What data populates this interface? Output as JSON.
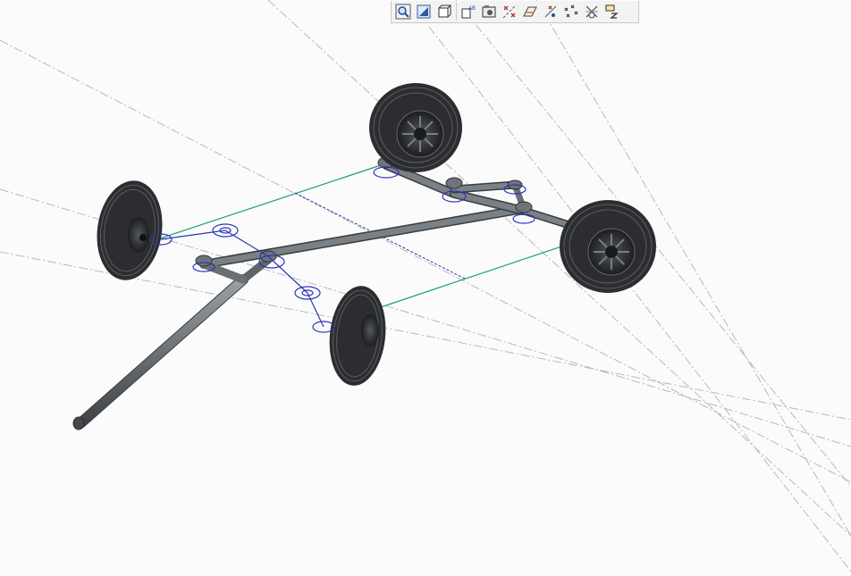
{
  "window": {
    "kind": "3d-cad-graphics-window"
  },
  "toolbar": {
    "buttons": [
      {
        "icon": "zoom-to-fit-icon"
      },
      {
        "icon": "zoom-area-icon"
      },
      {
        "icon": "view-orientation-icon"
      },
      {
        "icon": "annotation-display-icon",
        "glyph": "AB"
      },
      {
        "icon": "saved-views-icon"
      },
      {
        "icon": "datum-axis-display-icon"
      },
      {
        "icon": "datum-plane-display-icon"
      },
      {
        "icon": "datum-point-display-icon"
      },
      {
        "icon": "coordinate-system-display-icon"
      },
      {
        "icon": "spin-center-display-icon"
      },
      {
        "icon": "annotation-toggle-icon"
      }
    ]
  },
  "model": {
    "type": "wheeled-cart-chassis-assembly",
    "wheels": 4,
    "tube_color": "#6f7478",
    "tire_color": "#2b2d30",
    "datum_curve_color": "#1f9e73",
    "constraint_color": "#2a36b8",
    "datum_axis_color": "#b5b5b5"
  }
}
